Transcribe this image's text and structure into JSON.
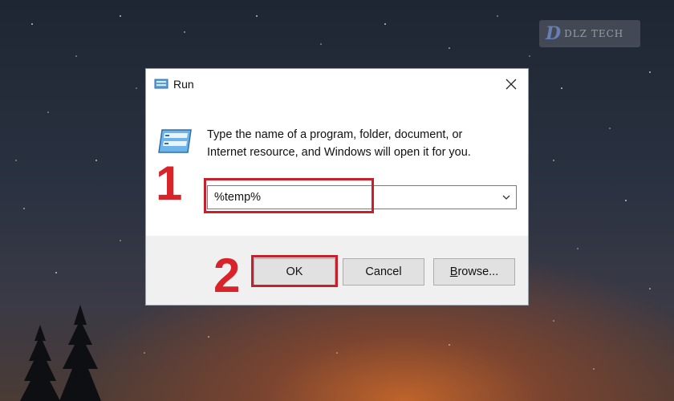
{
  "watermark": {
    "text": "DLZ TECH"
  },
  "dialog": {
    "title": "Run",
    "description_line1": "Type the name of a program, folder, document, or",
    "description_line2": "Internet resource, and Windows will open it for you.",
    "open_value": "%temp%",
    "buttons": {
      "ok": "OK",
      "cancel": "Cancel",
      "browse_first": "B",
      "browse_rest": "rowse..."
    }
  },
  "annotations": {
    "step1": "1",
    "step2": "2"
  },
  "colors": {
    "highlight": "#c8202a",
    "step_number": "#d8232a"
  }
}
